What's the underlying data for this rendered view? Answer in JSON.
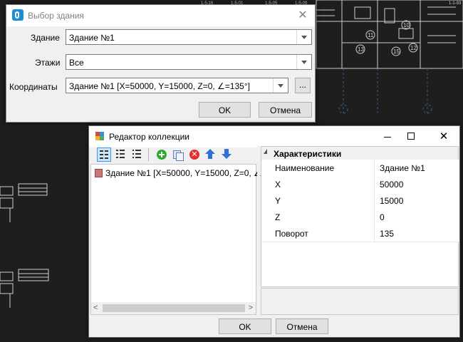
{
  "dialog1": {
    "title": "Выбор здания",
    "building_label": "Здание",
    "building_value": "Здание №1",
    "floors_label": "Этажи",
    "floors_value": "Все",
    "coords_label": "Координаты",
    "coords_value": "Здание №1 [X=50000, Y=15000, Z=0, ∠=135°]",
    "browse_label": "...",
    "ok_label": "OK",
    "cancel_label": "Отмена"
  },
  "editor": {
    "title": "Редактор коллекции",
    "list_items": [
      "Здание №1 [X=50000, Y=15000, Z=0, ∠=..."
    ],
    "category": "Характеристики",
    "properties": [
      {
        "name": "Наименование",
        "value": "Здание №1"
      },
      {
        "name": "X",
        "value": "50000"
      },
      {
        "name": "Y",
        "value": "15000"
      },
      {
        "name": "Z",
        "value": "0"
      },
      {
        "name": "Поворот",
        "value": "135"
      }
    ],
    "ok_label": "OK",
    "cancel_label": "Отмена"
  },
  "cad_background": {
    "room_numbers": [
      "10",
      "11",
      "12",
      "13",
      "15"
    ],
    "dim_labels": [
      "1-5-16",
      "1-5-01",
      "1-5-05",
      "1-5-09",
      "1-1-93"
    ]
  },
  "colors": {
    "window_bg": "#f0f0f0",
    "cad_bg": "#1e1e1e",
    "accent": "#3399ff",
    "add_icon": "#2fa82f",
    "delete_icon": "#e03030",
    "arrow_icon": "#2f6fd6"
  }
}
